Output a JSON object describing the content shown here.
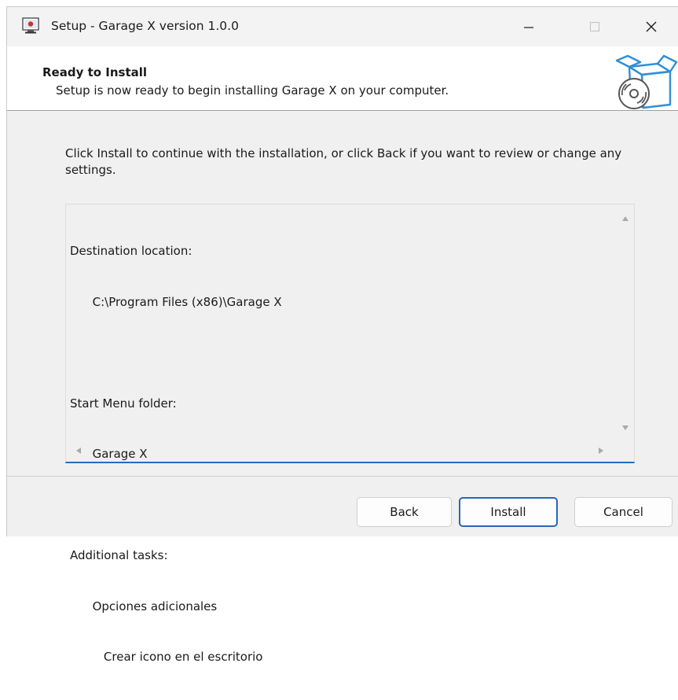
{
  "window": {
    "title": "Setup - Garage X version 1.0.0",
    "controls": {
      "minimize": "—",
      "close": "✕"
    }
  },
  "header": {
    "title": "Ready to Install",
    "subtitle": "Setup is now ready to begin installing Garage X on your computer."
  },
  "body": {
    "intro": "Click Install to continue with the installation, or click Back if you want to review or change any settings.",
    "memo": [
      "Destination location:",
      "      C:\\Program Files (x86)\\Garage X",
      "",
      "Start Menu folder:",
      "      Garage X",
      "",
      "Additional tasks:",
      "      Opciones adicionales",
      "         Crear icono en el escritorio"
    ]
  },
  "buttons": {
    "back": "Back",
    "install": "Install",
    "cancel": "Cancel"
  },
  "colors": {
    "accent": "#1f6fbf",
    "background": "#f0f0f0"
  },
  "icons": [
    "setup-app-icon",
    "minimize-icon",
    "maximize-icon",
    "close-icon",
    "install-box-disc-icon",
    "scroll-up-icon",
    "scroll-down-icon",
    "scroll-left-icon",
    "scroll-right-icon"
  ]
}
